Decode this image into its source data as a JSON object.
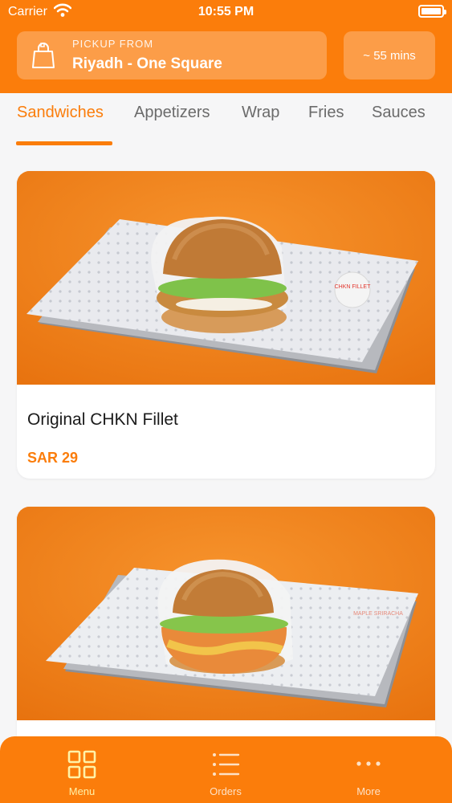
{
  "status_bar": {
    "carrier": "Carrier",
    "time": "10:55 PM",
    "icons": [
      "wifi-icon",
      "battery-icon"
    ]
  },
  "header": {
    "pickup_label": "PICKUP FROM",
    "pickup_store": "Riyadh - One Square",
    "eta": "~ 55 mins",
    "pickup_icon": "shopping-bag-icon",
    "accent_color": "#fb7d0b"
  },
  "categories": {
    "selected": "Sandwiches",
    "tabs": [
      {
        "label": "Sandwiches"
      },
      {
        "label": "Appetizers"
      },
      {
        "label": "Wrap"
      },
      {
        "label": "Fries"
      },
      {
        "label": "Sauces"
      }
    ]
  },
  "menu_items": [
    {
      "name": "Original CHKN Fillet",
      "price": "SAR 29",
      "tray_text": "CHKN FILLET"
    },
    {
      "name": "",
      "price": "",
      "tray_text": "MAPLE SRIRACHA"
    }
  ],
  "tab_bar": {
    "selected": "Menu",
    "items": [
      {
        "label": "Menu",
        "icon": "grid-icon"
      },
      {
        "label": "Orders",
        "icon": "list-icon"
      },
      {
        "label": "More",
        "icon": "more-dots-icon"
      }
    ],
    "active_color": "#fff2a8"
  }
}
